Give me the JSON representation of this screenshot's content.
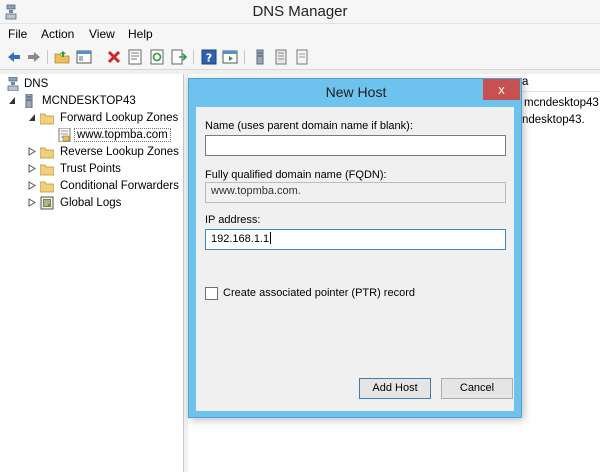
{
  "window": {
    "title": "DNS Manager"
  },
  "menu": {
    "file": "File",
    "action": "Action",
    "view": "View",
    "help": "Help"
  },
  "toolbar": {
    "icons": [
      "back-arrow-icon",
      "forward-arrow-icon",
      "folder-up-icon",
      "console-tree-icon",
      "delete-icon",
      "properties-icon",
      "refresh-icon",
      "export-list-icon",
      "help-icon",
      "show-pane-icon",
      "server-icon",
      "zone-icon",
      "file-icon"
    ]
  },
  "tree": {
    "root": "DNS",
    "server": "MCNDESKTOP43",
    "forward_zones": "Forward Lookup Zones",
    "zone": "www.topmba.com",
    "reverse_zones": "Reverse Lookup Zones",
    "trust_points": "Trust Points",
    "conditional_forwarders": "Conditional Forwarders",
    "global_logs": "Global Logs"
  },
  "right_pane": {
    "header_fragment": "a",
    "row1_fragment": "mcndesktop43",
    "row2_fragment": "ndesktop43."
  },
  "dialog": {
    "title": "New Host",
    "close_label": "x",
    "name_label": "Name (uses parent domain name if blank):",
    "name_value": "",
    "fqdn_label": "Fully qualified domain name (FQDN):",
    "fqdn_value": "www.topmba.com.",
    "ip_label": "IP address:",
    "ip_value": "192.168.1.1",
    "ptr_label": "Create associated pointer (PTR) record",
    "ptr_checked": false,
    "add_host_label": "Add Host",
    "cancel_label": "Cancel"
  },
  "colors": {
    "dialog_frame": "#6ec3ee",
    "close_button": "#c75050",
    "window_bg": "#f0f0f0"
  }
}
